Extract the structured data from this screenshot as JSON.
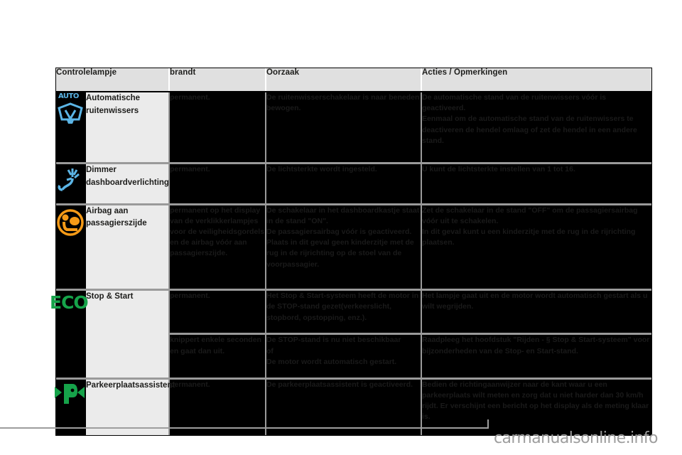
{
  "table": {
    "headers": {
      "icon": "",
      "control": "Controlelampje",
      "brandt": "brandt",
      "oorzaak": "Oorzaak",
      "acties": "Acties / Opmerkingen"
    },
    "rows": [
      {
        "icon_name": "auto-wiper-icon",
        "icon_label": "AUTO",
        "icon_color": "#5bb4e5",
        "name": "Automatische ruitenwissers",
        "brandt": "permanent.",
        "oorzaak": "De ruitenwisserschakelaar is naar beneden bewogen.",
        "acties": "De automatische stand van de ruitenwissers vóór is geactiveerd.\nEenmaal om de automatische stand van de ruitenwissers te deactiveren de hendel omlaag of zet de hendel in een andere stand."
      },
      {
        "icon_name": "dashboard-dimmer-icon",
        "icon_label": "",
        "icon_color": "#5bb4e5",
        "name": "Dimmer dashboardverlichting",
        "brandt": "permanent.",
        "oorzaak": "De lichtsterkte wordt ingesteld.",
        "acties": "U kunt de lichtsterkte instellen van 1 tot 16."
      },
      {
        "icon_name": "passenger-airbag-icon",
        "icon_label": "",
        "icon_color": "#f59a17",
        "name": "Airbag aan passagierszijde",
        "brandt": "permanent op het display van de verklikkerlampjes voor de veiligheidsgordels en de airbag vóór aan passagierszijde.",
        "oorzaak": "De schakelaar in het dashboardkastje staat in de stand \"ON\".\nDe passagiersairbag vóór is geactiveerd.\nPlaats in dit geval geen kinderzitje met de rug in de rijrichting op de stoel van de voorpassagier.",
        "acties": "Zet de schakelaar in de stand \"OFF\" om de passagiersairbag vóór uit te schakelen.\nIn dit geval kunt u een kinderzitje met de rug in de rijrichting plaatsen."
      },
      {
        "icon_name": "eco-stop-start-icon",
        "icon_label": "ECO",
        "icon_color": "#16a34a",
        "name": "Stop & Start",
        "subrows": [
          {
            "brandt": "permanent.",
            "oorzaak": "Het Stop & Start-systeem heeft de motor in de STOP-stand gezet(verkeerslicht, stopbord, opstopping, enz.).",
            "acties": "Het lampje gaat uit en de motor wordt automatisch gestart als u wilt wegrijden."
          },
          {
            "brandt": "knippert enkele seconden en gaat dan uit.",
            "oorzaak": "De STOP-stand is nu niet beschikbaar\nof\nDe motor wordt automatisch gestart.",
            "acties": "Raadpleeg het hoofdstuk \"Rijden - §  Stop & Start-systeem\" voor bijzonderheden van de Stop- en Start-stand."
          }
        ]
      },
      {
        "icon_name": "park-assist-icon",
        "icon_label": "P",
        "icon_color": "#16a34a",
        "name": "Parkeerplaatsassistent",
        "brandt": "permanent.",
        "oorzaak": "De parkeerplaatsassistent is geactiveerd.",
        "acties": "Bedien de richtingaanwijzer naar de kant waar u een parkeerplaats wilt meten en zorg dat u niet harder dan 30 km/h rijdt. Er verschijnt een bericht op het display als de meting klaar is."
      }
    ]
  },
  "watermark": {
    "text": "carmanualsonline.info"
  }
}
